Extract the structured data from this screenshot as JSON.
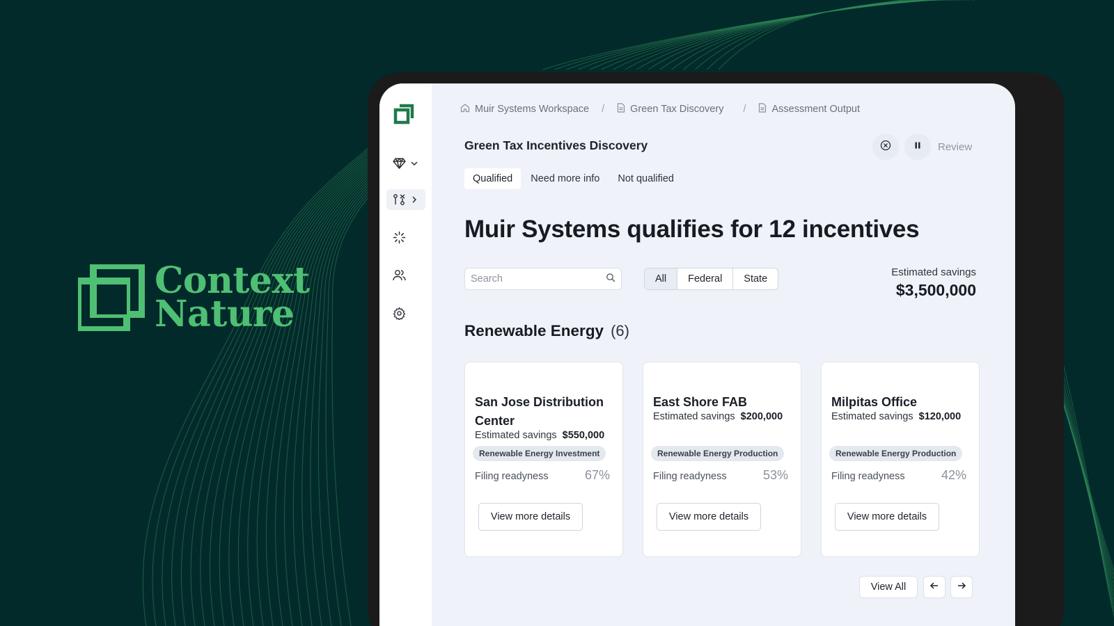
{
  "brand": {
    "line1": "Context",
    "line2": "Nature",
    "color": "#4fbf73"
  },
  "breadcrumb": [
    {
      "label": "Muir Systems Workspace",
      "icon": "home-icon"
    },
    {
      "label": "Green Tax Discovery",
      "icon": "document-icon"
    },
    {
      "label": "Assessment Output",
      "icon": "document-icon"
    }
  ],
  "breadcrumb_separator": "/",
  "page": {
    "title": "Green Tax Incentives Discovery",
    "review_label": "Review",
    "headline": "Muir Systems qualifies for 12 incentives"
  },
  "tabs": [
    "Qualified",
    "Need more info",
    "Not qualified"
  ],
  "search": {
    "placeholder": "Search",
    "value": ""
  },
  "filters": [
    "All",
    "Federal",
    "State"
  ],
  "estimated": {
    "label": "Estimated savings",
    "value": "$3,500,000"
  },
  "section": {
    "name": "Renewable Energy",
    "count": "(6)"
  },
  "cards": [
    {
      "name": "San Jose Distribution Center",
      "savings_label": "Estimated savings",
      "savings": "$550,000",
      "tag": "Renewable Energy Investment",
      "readiness_label": "Filing readyness",
      "readiness": "67%",
      "button": "View more details"
    },
    {
      "name": "East Shore FAB",
      "savings_label": "Estimated savings",
      "savings": "$200,000",
      "tag": "Renewable Energy Production",
      "readiness_label": "Filing readyness",
      "readiness": "53%",
      "button": "View more details"
    },
    {
      "name": "Milpitas Office",
      "savings_label": "Estimated savings",
      "savings": "$120,000",
      "tag": "Renewable Energy Production",
      "readiness_label": "Filing readyness",
      "readiness": "42%",
      "button": "View more details"
    }
  ],
  "pager": {
    "view_all": "View All"
  },
  "sidebar_icons": [
    "gem-icon",
    "compare-icon",
    "loader-icon",
    "users-icon",
    "gear-icon"
  ],
  "colors": {
    "background": "#032a2b",
    "accent": "#4fbf73",
    "logo_green": "#1f7a4a",
    "screen": "#eff2f8"
  }
}
